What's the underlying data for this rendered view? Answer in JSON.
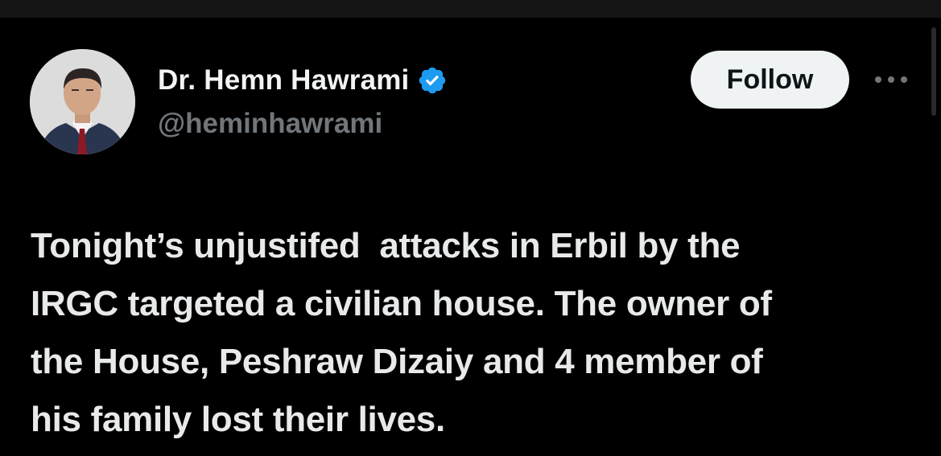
{
  "author": {
    "display_name": "Dr. Hemn Hawrami",
    "handle": "@heminhawrami",
    "verified": true
  },
  "actions": {
    "follow_label": "Follow"
  },
  "tweet": {
    "lines": [
      "Tonight’s unjustifed  attacks in Erbil by the",
      "IRGC targeted a civilian house. The owner of",
      "the House, Peshraw Dizaiy and 4 member of",
      "his family lost their lives."
    ]
  },
  "colors": {
    "background": "#000000",
    "text": "#e7e9ea",
    "muted": "#71767b",
    "verified_blue": "#1d9bf0",
    "follow_bg": "#eff3f4"
  },
  "icons": {
    "verified": "verified-badge-icon",
    "more": "more-options-icon"
  }
}
